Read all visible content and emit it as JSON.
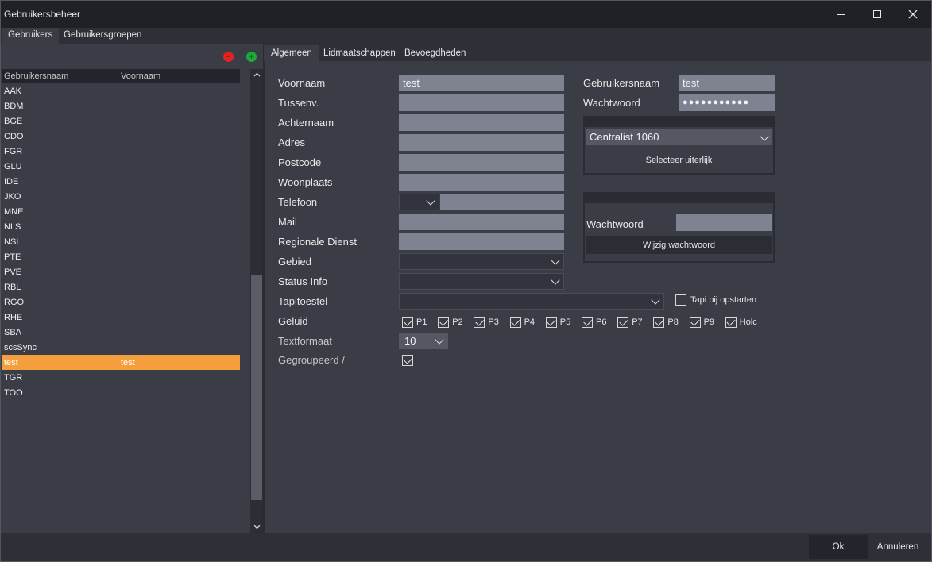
{
  "window": {
    "title": "Gebruikersbeheer"
  },
  "top_tabs": [
    "Gebruikers",
    "Gebruikersgroepen"
  ],
  "user_list": {
    "columns": [
      "Gebruikersnaam",
      "Voornaam"
    ],
    "rows": [
      {
        "username": "AAK",
        "firstname": ""
      },
      {
        "username": "BDM",
        "firstname": ""
      },
      {
        "username": "BGE",
        "firstname": ""
      },
      {
        "username": "CDO",
        "firstname": ""
      },
      {
        "username": "FGR",
        "firstname": ""
      },
      {
        "username": "GLU",
        "firstname": ""
      },
      {
        "username": "IDE",
        "firstname": ""
      },
      {
        "username": "JKO",
        "firstname": ""
      },
      {
        "username": "MNE",
        "firstname": ""
      },
      {
        "username": "NLS",
        "firstname": ""
      },
      {
        "username": "NSI",
        "firstname": ""
      },
      {
        "username": "PTE",
        "firstname": ""
      },
      {
        "username": "PVE",
        "firstname": ""
      },
      {
        "username": "RBL",
        "firstname": ""
      },
      {
        "username": "RGO",
        "firstname": ""
      },
      {
        "username": "RHE",
        "firstname": ""
      },
      {
        "username": "SBA",
        "firstname": ""
      },
      {
        "username": "scsSync",
        "firstname": ""
      },
      {
        "username": "test",
        "firstname": "test"
      },
      {
        "username": "TGR",
        "firstname": ""
      },
      {
        "username": "TOO",
        "firstname": ""
      }
    ],
    "selected_index": 18
  },
  "detail_tabs": [
    "Algemeen",
    "Lidmaatschappen",
    "Bevoegdheden"
  ],
  "form": {
    "voornaam": {
      "label": "Voornaam",
      "value": "test"
    },
    "tussenv": {
      "label": "Tussenv.",
      "value": ""
    },
    "achternaam": {
      "label": "Achternaam",
      "value": ""
    },
    "adres": {
      "label": "Adres",
      "value": ""
    },
    "postcode": {
      "label": "Postcode",
      "value": ""
    },
    "woonplaats": {
      "label": "Woonplaats",
      "value": ""
    },
    "telefoon": {
      "label": "Telefoon",
      "value": ""
    },
    "mail": {
      "label": "Mail",
      "value": ""
    },
    "regionale_dienst": {
      "label": "Regionale Dienst",
      "value": ""
    },
    "gebied": {
      "label": "Gebied",
      "value": ""
    },
    "status_info": {
      "label": "Status Info",
      "value": ""
    },
    "tapitoestel": {
      "label": "Tapitoestel",
      "value": ""
    },
    "tapi_bij_opstarten": {
      "label": "Tapi bij opstarten",
      "checked": false
    },
    "geluid": {
      "label": "Geluid",
      "options": [
        {
          "label": "P1",
          "checked": true
        },
        {
          "label": "P2",
          "checked": true
        },
        {
          "label": "P3",
          "checked": true
        },
        {
          "label": "P4",
          "checked": true
        },
        {
          "label": "P5",
          "checked": true
        },
        {
          "label": "P6",
          "checked": true
        },
        {
          "label": "P7",
          "checked": true
        },
        {
          "label": "P8",
          "checked": true
        },
        {
          "label": "P9",
          "checked": true
        },
        {
          "label": "Holc",
          "checked": true
        }
      ]
    },
    "textformaat": {
      "label": "Textformaat",
      "value": "10"
    },
    "gegroupeerd": {
      "label": "Gegroupeerd /",
      "checked": true
    }
  },
  "account": {
    "gebruikersnaam": {
      "label": "Gebruikersnaam",
      "value": "test"
    },
    "wachtwoord": {
      "label": "Wachtwoord",
      "value": "●●●●●●●●●●●"
    },
    "appearance_select": "Centralist 1060",
    "appearance_button": "Selecteer uiterlijk",
    "new_password_label": "Wachtwoord",
    "new_password_value": "",
    "change_password_button": "Wijzig wachtwoord"
  },
  "footer": {
    "ok": "Ok",
    "cancel": "Annuleren"
  },
  "colors": {
    "selected_row": "#f59e3e",
    "remove": "#e02222",
    "add": "#1fa83a"
  }
}
